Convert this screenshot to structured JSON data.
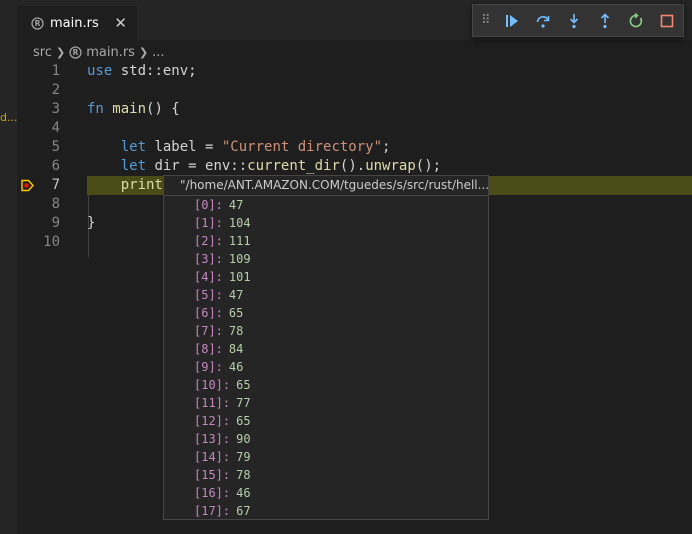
{
  "tab": {
    "filename": "main.rs"
  },
  "breadcrumb": {
    "folder": "src",
    "file": "main.rs",
    "ellipsis": "..."
  },
  "left_panel_fragment": "d...",
  "debug_toolbar": {
    "buttons": [
      "continue",
      "step-over",
      "step-into",
      "step-out",
      "restart",
      "stop"
    ],
    "colors": {
      "blue": "#75beff",
      "green": "#89d185",
      "red": "#f48771"
    }
  },
  "editor": {
    "line_numbers": [
      "1",
      "2",
      "3",
      "4",
      "5",
      "6",
      "7",
      "8",
      "9",
      "10"
    ],
    "current_line": "7",
    "lines": [
      {
        "num": "1",
        "tokens": [
          [
            "kw",
            "use"
          ],
          [
            "plain",
            " std::env;"
          ]
        ]
      },
      {
        "num": "2",
        "tokens": []
      },
      {
        "num": "3",
        "tokens": [
          [
            "kw",
            "fn"
          ],
          [
            "plain",
            " "
          ],
          [
            "fn",
            "main"
          ],
          [
            "plain",
            "() {"
          ]
        ]
      },
      {
        "num": "4",
        "tokens": []
      },
      {
        "num": "5",
        "tokens": [
          [
            "plain",
            "    "
          ],
          [
            "kw",
            "let"
          ],
          [
            "plain",
            " label = "
          ],
          [
            "str",
            "\"Current directory\""
          ],
          [
            "plain",
            ";"
          ]
        ]
      },
      {
        "num": "6",
        "tokens": [
          [
            "plain",
            "    "
          ],
          [
            "kw",
            "let"
          ],
          [
            "plain",
            " dir = env::"
          ],
          [
            "fn",
            "current_dir"
          ],
          [
            "plain",
            "()."
          ],
          [
            "fn",
            "unwrap"
          ],
          [
            "plain",
            "();"
          ]
        ]
      },
      {
        "num": "7",
        "tokens": [
          [
            "plain",
            "    "
          ],
          [
            "fn",
            "print"
          ]
        ]
      },
      {
        "num": "8",
        "tokens": []
      },
      {
        "num": "9",
        "tokens": [
          [
            "plain",
            "}"
          ]
        ]
      },
      {
        "num": "10",
        "tokens": []
      }
    ]
  },
  "hover": {
    "header": "\"/home/ANT.AMAZON.COM/tguedes/s/src/rust/hell...",
    "items": [
      {
        "index": "[0]:",
        "value": "47"
      },
      {
        "index": "[1]:",
        "value": "104"
      },
      {
        "index": "[2]:",
        "value": "111"
      },
      {
        "index": "[3]:",
        "value": "109"
      },
      {
        "index": "[4]:",
        "value": "101"
      },
      {
        "index": "[5]:",
        "value": "47"
      },
      {
        "index": "[6]:",
        "value": "65"
      },
      {
        "index": "[7]:",
        "value": "78"
      },
      {
        "index": "[8]:",
        "value": "84"
      },
      {
        "index": "[9]:",
        "value": "46"
      },
      {
        "index": "[10]:",
        "value": "65"
      },
      {
        "index": "[11]:",
        "value": "77"
      },
      {
        "index": "[12]:",
        "value": "65"
      },
      {
        "index": "[13]:",
        "value": "90"
      },
      {
        "index": "[14]:",
        "value": "79"
      },
      {
        "index": "[15]:",
        "value": "78"
      },
      {
        "index": "[16]:",
        "value": "46"
      },
      {
        "index": "[17]:",
        "value": "67"
      }
    ]
  }
}
